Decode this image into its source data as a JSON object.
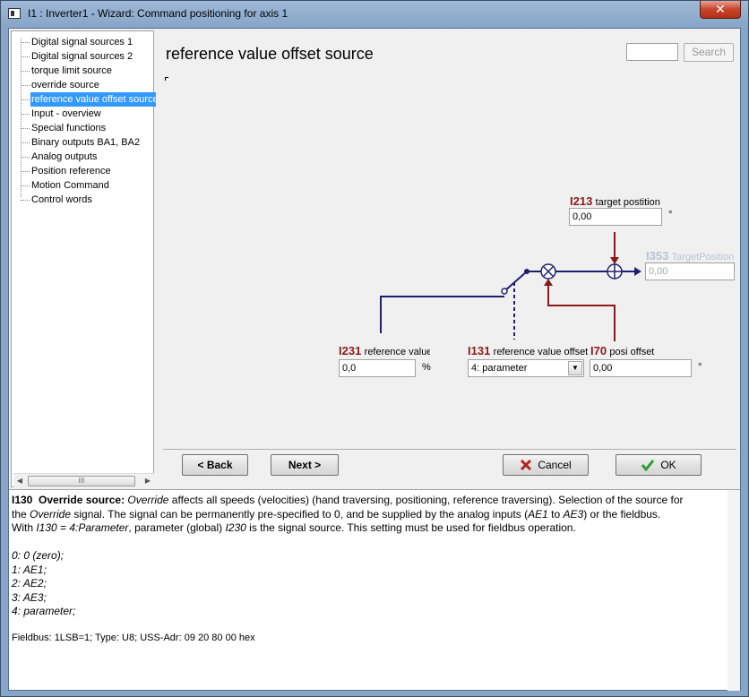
{
  "window": {
    "title": "I1 : Inverter1 - Wizard: Command positioning for axis 1",
    "close_glyph": "✕"
  },
  "tree": {
    "items": [
      {
        "label": "Digital signal sources 1",
        "selected": false
      },
      {
        "label": "Digital signal sources 2",
        "selected": false
      },
      {
        "label": "torque limit source",
        "selected": false
      },
      {
        "label": "override source",
        "selected": false
      },
      {
        "label": "reference value offset source",
        "selected": true
      },
      {
        "label": "Input - overview",
        "selected": false
      },
      {
        "label": "Special functions",
        "selected": false
      },
      {
        "label": "Binary outputs BA1, BA2",
        "selected": false
      },
      {
        "label": "Analog outputs",
        "selected": false
      },
      {
        "label": "Position reference",
        "selected": false
      },
      {
        "label": "Motion Command",
        "selected": false
      },
      {
        "label": "Control words",
        "selected": false
      }
    ],
    "scroll_left": "◀",
    "scroll_right": "▶",
    "scroll_grip": "III"
  },
  "main": {
    "title": "reference value offset source",
    "search": {
      "value": "",
      "button_label": "Search"
    },
    "diagram": {
      "target_position": {
        "code": "I213",
        "name": "target postition",
        "value": "0,00",
        "unit": "°"
      },
      "target_position_out": {
        "code": "I353",
        "name": "TargetPosition",
        "value": "0,00"
      },
      "reference_value": {
        "code": "I231",
        "name": "reference value",
        "value": "0,0",
        "unit": "%"
      },
      "reference_value_offset": {
        "code": "I131",
        "name": "reference value offset",
        "selected": "4: parameter",
        "arrow": "▼"
      },
      "posi_offset": {
        "code": "I70",
        "name": "posi offset",
        "value": "0,00",
        "unit": "°"
      },
      "colors": {
        "signal": "#1f1f6e",
        "offset": "#8b1a1a"
      }
    },
    "buttons": {
      "back": "< Back",
      "next": "Next >",
      "cancel": "Cancel",
      "ok": "OK"
    }
  },
  "help": {
    "heading_code": "I130",
    "heading_title": "Override source:",
    "line1_a": "Override",
    "line1_b": " affects all speeds (velocities) (hand traversing, positioning, reference traversing). Selection of the source for",
    "line2_a": "the ",
    "line2_b": "Override",
    "line2_c": " signal. The signal can be permanently pre-specified to 0, and be supplied by the analog inputs (",
    "line2_d": "AE1",
    "line2_e": " to ",
    "line2_f": "AE3",
    "line2_g": ") or the fieldbus.",
    "line3_a": "With ",
    "line3_b": "I130 = 4:Parameter",
    "line3_c": ", parameter (global) ",
    "line3_d": "I230",
    "line3_e": " is the signal source. This setting must be used for fieldbus operation.",
    "options": [
      "0:  0 (zero);",
      "1:  AE1;",
      "2:  AE2;",
      "3:  AE3;",
      "4:  parameter;"
    ],
    "fieldbus": "Fieldbus: 1LSB=1; Type: U8; USS-Adr: 09 20 80 00 hex"
  }
}
